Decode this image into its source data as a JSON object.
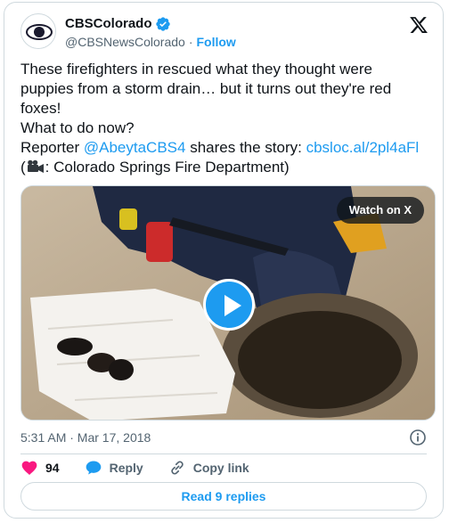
{
  "author": {
    "display_name": "CBSColorado",
    "handle": "@CBSNewsColorado",
    "separator": "·",
    "follow_label": "Follow"
  },
  "tweet": {
    "line1": "These firefighters in rescued what they thought were",
    "line2": "puppies from a storm drain… but it turns out they're red",
    "line3": "foxes!",
    "line4": "What to do now?",
    "line5_prefix": "Reporter ",
    "mention": "@AbeytaCBS4",
    "line5_middle": " shares the story: ",
    "link": "cbsloc.al/2pl4aFl",
    "line6_open": "(",
    "line6_rest": ": Colorado Springs Fire Department)"
  },
  "media": {
    "watch_label": "Watch on X"
  },
  "timestamp": "5:31 AM · Mar 17, 2018",
  "actions": {
    "likes": "94",
    "reply_label": "Reply",
    "copy_link_label": "Copy link"
  },
  "replies_button": "Read 9 replies",
  "colors": {
    "accent": "#1d9bf0",
    "like": "#f91880",
    "muted": "#536471"
  }
}
